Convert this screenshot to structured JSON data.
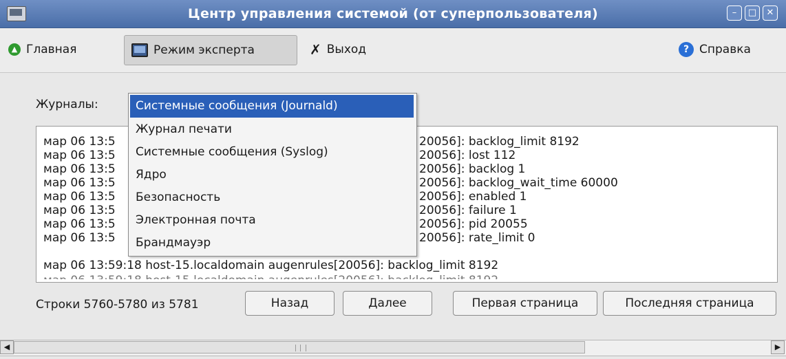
{
  "window": {
    "title": "Центр управления системой (от суперпользователя)",
    "controls": {
      "minimize": "–",
      "maximize": "□",
      "close": "✕"
    }
  },
  "toolbar": {
    "home_label": "Главная",
    "expert_label": "Режим эксперта",
    "exit_label": "Выход",
    "help_label": "Справка"
  },
  "journals": {
    "label": "Журналы:",
    "options": [
      "Системные сообщения (Journald)",
      "Журнал печати",
      "Системные сообщения (Syslog)",
      "Ядро",
      "Безопасность",
      "Электронная почта",
      "Брандмауэр"
    ],
    "selected": "Системные сообщения (Journald)"
  },
  "log": {
    "lines_visible_left": [
      "мар 06 13:5",
      "мар 06 13:5",
      "мар 06 13:5",
      "мар 06 13:5",
      "мар 06 13:5",
      "мар 06 13:5",
      "мар 06 13:5",
      "мар 06 13:5"
    ],
    "lines_visible_right": [
      "20056]: backlog_limit 8192",
      "20056]: lost 112",
      "20056]: backlog 1",
      "20056]: backlog_wait_time 60000",
      "20056]: enabled 1",
      "20056]: failure 1",
      "20056]: pid 20055",
      "20056]: rate_limit 0"
    ],
    "full_line": "мар 06 13:59:18 host-15.localdomain augenrules[20056]: backlog_limit 8192"
  },
  "footer": {
    "range_text": "Строки 5760-5780 из 5781",
    "back_label": "Назад",
    "next_label": "Далее",
    "first_label": "Первая страница",
    "last_label": "Последняя страница"
  },
  "scrollbar": {
    "left_arrow": "◀",
    "right_arrow": "▶"
  }
}
